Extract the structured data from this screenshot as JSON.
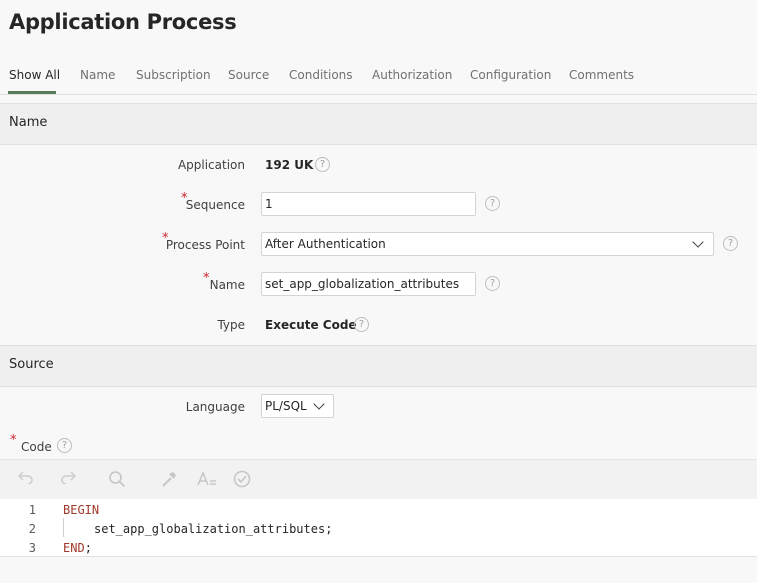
{
  "page": {
    "title": "Application Process"
  },
  "tabs": [
    "Show All",
    "Name",
    "Subscription",
    "Source",
    "Conditions",
    "Authorization",
    "Configuration",
    "Comments"
  ],
  "sections": {
    "name": "Name",
    "source": "Source"
  },
  "fields": {
    "application": {
      "label": "Application",
      "value": "192 UK"
    },
    "sequence": {
      "label": "Sequence",
      "value": "1"
    },
    "process_point": {
      "label": "Process Point",
      "value": "After Authentication"
    },
    "name": {
      "label": "Name",
      "value": "set_app_globalization_attributes"
    },
    "type": {
      "label": "Type",
      "value": "Execute Code"
    },
    "language": {
      "label": "Language",
      "value": "PL/SQL"
    },
    "code": {
      "label": "Code"
    }
  },
  "required_marker": "*",
  "help_glyph": "?",
  "editor": {
    "toolbar_icons": [
      "undo-icon",
      "redo-icon",
      "search-icon",
      "hammer-icon",
      "text-style-icon",
      "validate-icon"
    ],
    "line_numbers": [
      "1",
      "2",
      "3"
    ],
    "lines": {
      "l1_keyword": "BEGIN",
      "l2_text": "set_app_globalization_attributes;",
      "l3_keyword": "END",
      "l3_text": ";"
    }
  }
}
